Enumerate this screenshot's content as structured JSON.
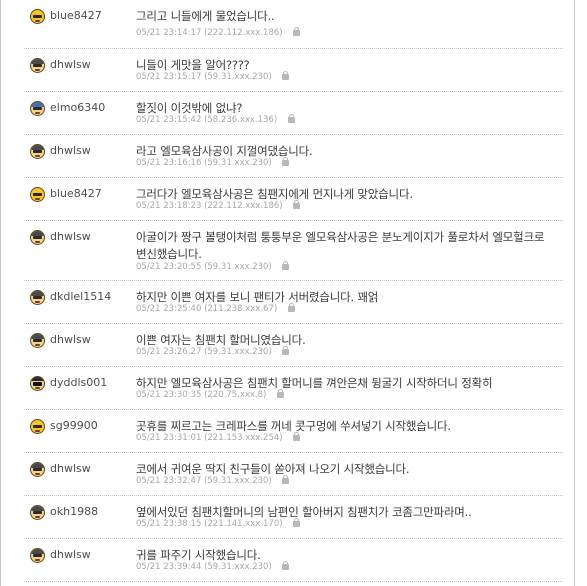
{
  "comments": [
    {
      "user": "blue8427",
      "avatar": "yellow-face-avatar",
      "text": "그리고 니들에게 물었습니다..",
      "time": "05/21 23:14:17",
      "ip": "(222.112.xxx.186)"
    },
    {
      "user": "dhwlsw",
      "avatar": "cap-avatar",
      "text": "니들이 게맛을 알어????",
      "time": "05/21 23:15:17",
      "ip": "(59.31.xxx.230)"
    },
    {
      "user": "elmo6340",
      "avatar": "blue-cap-avatar",
      "text": "할짓이 이것밖에 없냐?",
      "time": "05/21 23:15:42",
      "ip": "(58.236.xxx.136)"
    },
    {
      "user": "dhwlsw",
      "avatar": "cap-avatar",
      "text": "라고 엘모육삼사공이 지껄여댔습니다.",
      "time": "05/21 23:16:16",
      "ip": "(59.31.xxx.230)"
    },
    {
      "user": "blue8427",
      "avatar": "yellow-face-avatar",
      "text": "그러다가 엘모육삼사공은 침팬지에게 먼지나게 맞았습니다.",
      "time": "05/21 23:18:23",
      "ip": "(222.112.xxx.186)"
    },
    {
      "user": "dhwlsw",
      "avatar": "cap-avatar",
      "text": "아굴이가 짱구 볼탱이처럼 퉁퉁부운 엘모육삼사공은 분노게이지가 풀로차서 엘모헐크로 변신했습니다.",
      "time": "05/21 23:20:55",
      "ip": "(59.31.xxx.230)"
    },
    {
      "user": "dkdlel1514",
      "avatar": "cap-avatar",
      "text": "하지만 이쁜 여자를 보니 팬티가 서버렸습니다. 꽤얽",
      "time": "05/21 23:25:40",
      "ip": "(211.238.xxx.67)"
    },
    {
      "user": "dhwlsw",
      "avatar": "cap-avatar",
      "text": "이쁜 여자는 침팬치 할머니였습니다.",
      "time": "05/21 23:26:27",
      "ip": "(59.31.xxx.230)"
    },
    {
      "user": "dyddls001",
      "avatar": "sunglasses-avatar",
      "text": "하지만 엘모육삼사공은 침팬치 할머니를 껴안은채 뒹굴기 시작하더니 정확히",
      "time": "05/21 23:30:35",
      "ip": "(220.75.xxx.8)"
    },
    {
      "user": "sg99900",
      "avatar": "yellow-face-avatar",
      "text": "곳휴를 찌르고는 크레파스를 꺼네 콧구멍에 쑤셔넣기 시작했습니다.",
      "time": "05/21 23:31:01",
      "ip": "(221.153.xxx.254)"
    },
    {
      "user": "dhwlsw",
      "avatar": "cap-avatar",
      "text": "코에서 귀여운 딱지 친구들이 쏟아져 나오기 시작했습니다.",
      "time": "05/21 23:32:47",
      "ip": "(59.31.xxx.230)"
    },
    {
      "user": "okh1988",
      "avatar": "cap-avatar",
      "text": "옆에서있던 침팬치할머니의 남편인 할아버지 침팬치가 코좀그만파라며..",
      "time": "05/21 23:38:15",
      "ip": "(221.141.xxx.170)"
    },
    {
      "user": "dhwlsw",
      "avatar": "cap-avatar",
      "text": "귀를 파주기 시작했습니다.",
      "time": "05/21 23:39:44",
      "ip": "(59.31.xxx.230)"
    }
  ]
}
